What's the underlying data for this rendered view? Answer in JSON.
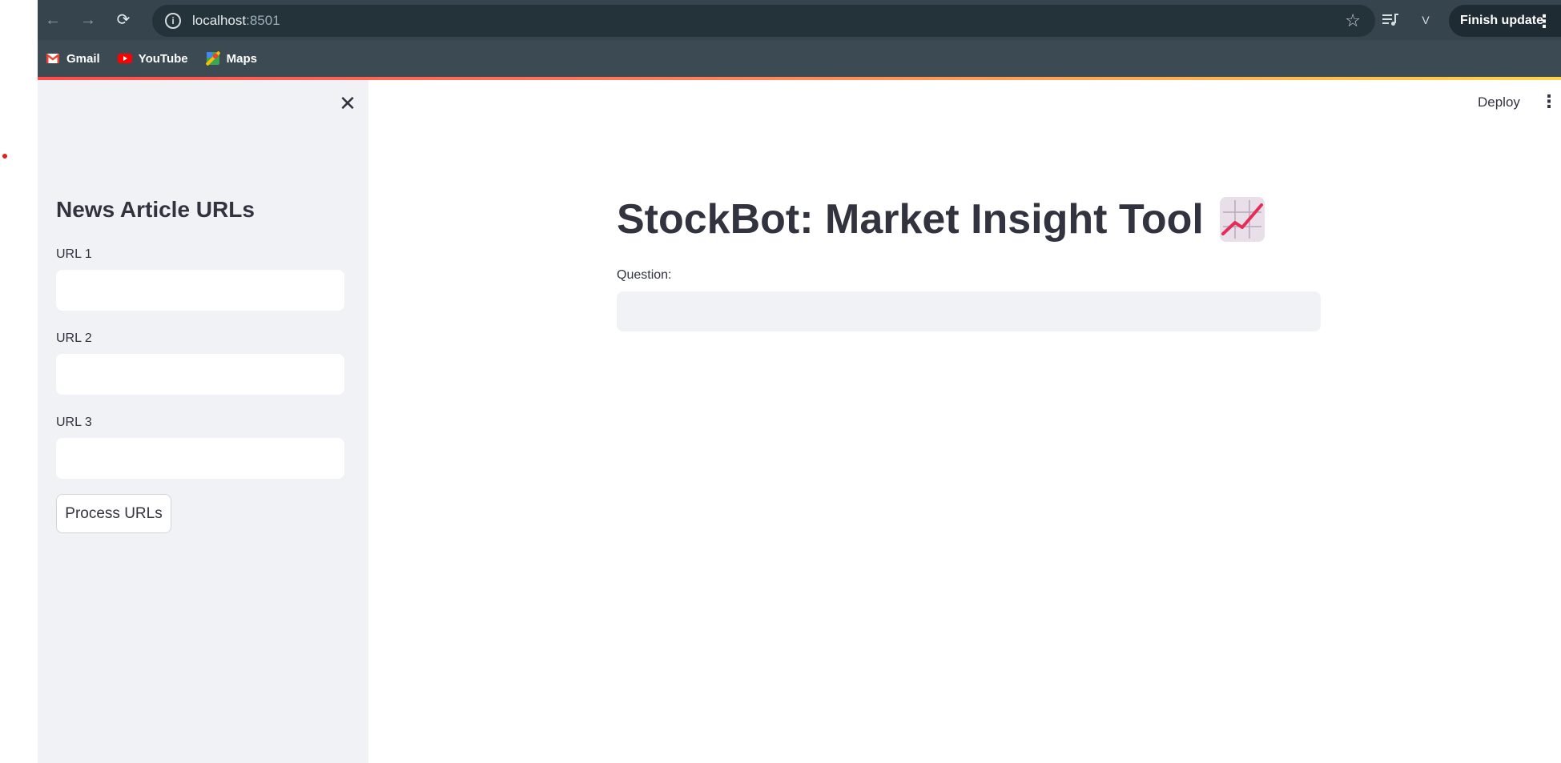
{
  "browser": {
    "url_host": "localhost",
    "url_port": ":8501",
    "profile_initial": "V",
    "finish_update_label": "Finish update",
    "bookmarks": [
      {
        "label": "Gmail",
        "icon": "gmail-icon"
      },
      {
        "label": "YouTube",
        "icon": "youtube-icon"
      },
      {
        "label": "Maps",
        "icon": "maps-icon"
      }
    ]
  },
  "app": {
    "deploy_label": "Deploy",
    "title": "StockBot: Market Insight Tool",
    "title_emoji": "chart-increasing-icon",
    "question_label": "Question:",
    "question_value": ""
  },
  "sidebar": {
    "title": "News Article URLs",
    "fields": [
      {
        "label": "URL 1",
        "value": ""
      },
      {
        "label": "URL 2",
        "value": ""
      },
      {
        "label": "URL 3",
        "value": ""
      }
    ],
    "process_button_label": "Process URLs"
  },
  "colors": {
    "sidebar_bg": "#f0f2f6",
    "text": "#31333f",
    "accent_gradient_start": "#ff4b4b",
    "accent_gradient_end": "#ffd44a"
  }
}
